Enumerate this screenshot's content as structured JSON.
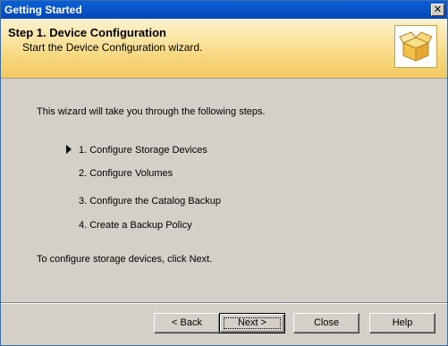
{
  "window": {
    "title": "Getting Started",
    "close_glyph": "✕"
  },
  "header": {
    "title": "Step 1.  Device Configuration",
    "subtitle": "Start the Device Configuration wizard.",
    "icon": "open-box-icon"
  },
  "content": {
    "intro": "This wizard will take you through the following steps.",
    "steps": [
      {
        "label": "1.  Configure Storage Devices",
        "current": true
      },
      {
        "label": "2.  Configure Volumes",
        "current": false
      },
      {
        "label": "3.  Configure the Catalog Backup",
        "current": false
      },
      {
        "label": "4.  Create a Backup Policy",
        "current": false
      }
    ],
    "outro": "To configure storage devices, click Next."
  },
  "buttons": {
    "back": "< Back",
    "next": "Next >",
    "close": "Close",
    "help": "Help"
  }
}
